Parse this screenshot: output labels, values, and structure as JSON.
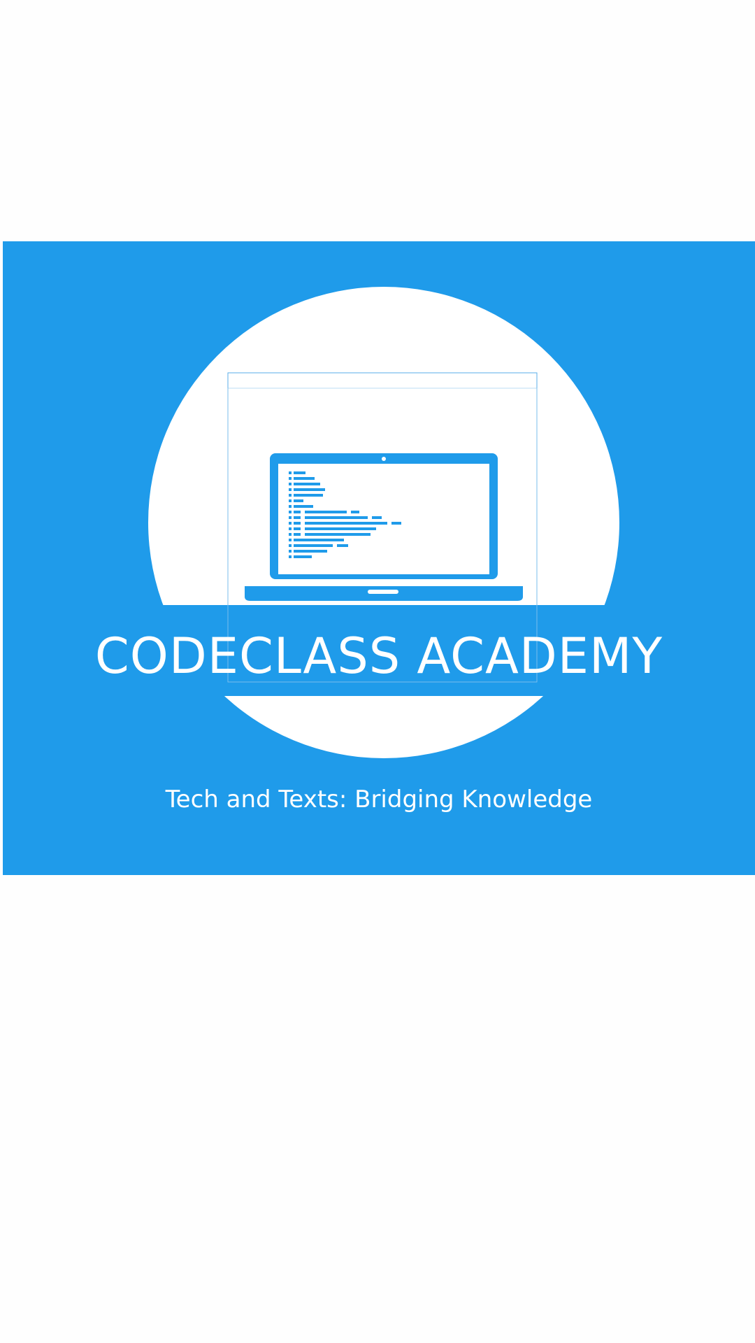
{
  "brand": {
    "title": "CODECLASS ACADEMY",
    "tagline": "Tech and Texts: Bridging Knowledge"
  },
  "logo": {
    "icon": "laptop-code-icon",
    "background_color": "#1f9bea",
    "circle_color": "#ffffff",
    "screen_color": "#1f9bea"
  }
}
